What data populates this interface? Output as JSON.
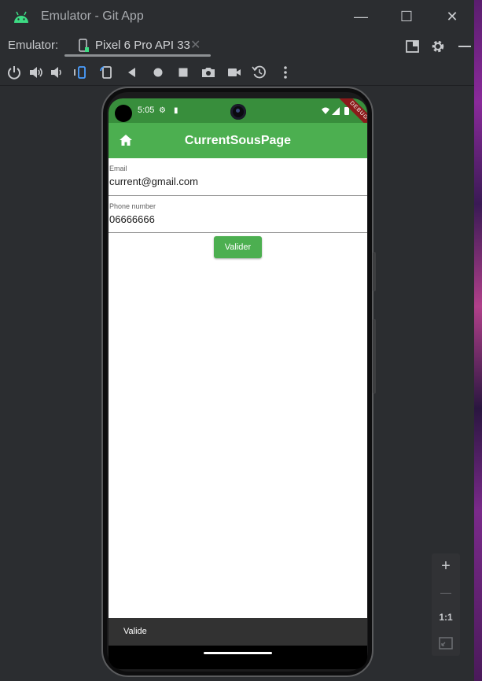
{
  "window": {
    "title": "Emulator - Git App",
    "controls": {
      "minimize": "—",
      "maximize": "☐",
      "close": "✕"
    }
  },
  "tabbar": {
    "label": "Emulator:",
    "device_tab": "Pixel 6 Pro API 33",
    "close": "✕"
  },
  "toolbar": {
    "icons": [
      "power-icon",
      "volume-up-icon",
      "volume-down-icon",
      "rotate-left-icon",
      "rotate-right-icon",
      "back-icon",
      "home-icon",
      "overview-icon",
      "camera-icon",
      "video-icon",
      "snapshot-icon",
      "more-icon"
    ]
  },
  "device": {
    "status_bar": {
      "time": "5:05"
    },
    "debug_ribbon": "DEBUG",
    "app_bar": {
      "title": "CurrentSousPage"
    },
    "form": {
      "email": {
        "label": "Email",
        "value": "current@gmail.com"
      },
      "phone": {
        "label": "Phone number",
        "value": "06666666"
      },
      "submit": "Valider"
    },
    "bottom_bar": {
      "label": "Valide"
    }
  },
  "zoom": {
    "zoom_in": "+",
    "zoom_out": "—",
    "actual_size": "1:1"
  },
  "colors": {
    "app_bar": "#4caf50",
    "status_bar": "#388e3c",
    "ide_background": "#2b2d30"
  }
}
